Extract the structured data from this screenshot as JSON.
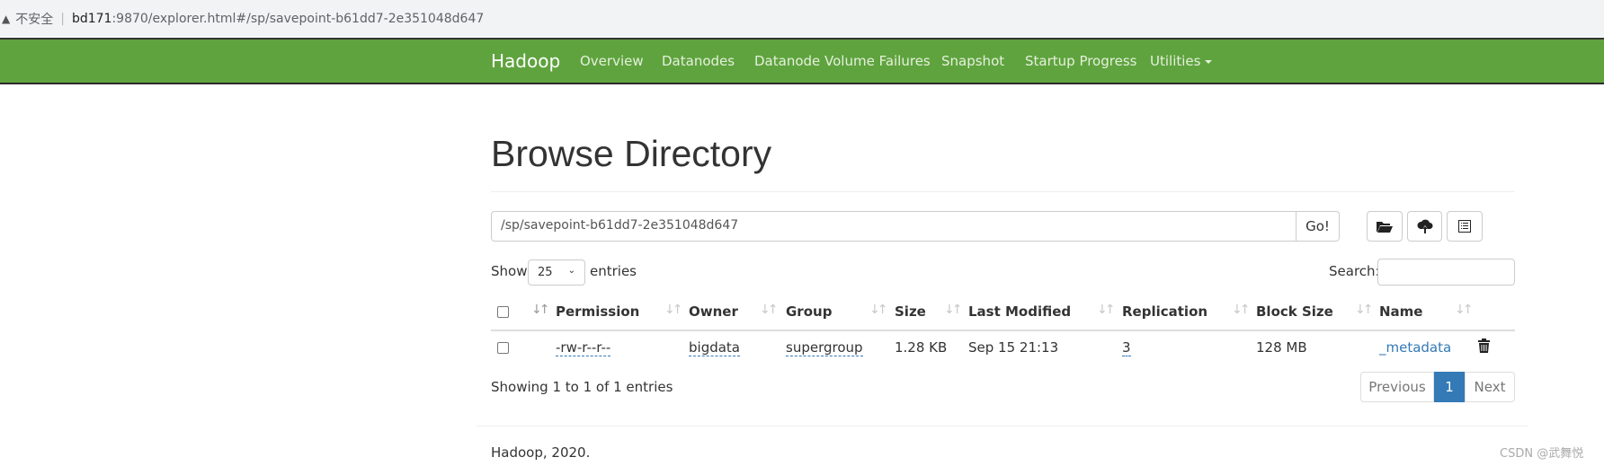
{
  "browser": {
    "warning_icon": "warning-triangle-icon",
    "insecure_label": "不安全",
    "url_host": "bd171",
    "url_rest": ":9870/explorer.html#/sp/savepoint-b61dd7-2e351048d647"
  },
  "nav": {
    "brand": "Hadoop",
    "items": [
      "Overview",
      "Datanodes",
      "Datanode Volume Failures",
      "Snapshot",
      "Startup Progress",
      "Utilities"
    ],
    "color": "#5fa33e"
  },
  "page": {
    "title": "Browse Directory"
  },
  "path": {
    "value": "/sp/savepoint-b61dd7-2e351048d647",
    "go_label": "Go!"
  },
  "toolbar": {
    "icons": [
      "folder-open-icon",
      "cloud-upload-icon",
      "list-alt-icon"
    ]
  },
  "table_controls": {
    "show_label": "Show",
    "entries_value": "25",
    "entries_label": "entries",
    "search_label": "Search:",
    "search_value": ""
  },
  "table": {
    "columns": [
      "Permission",
      "Owner",
      "Group",
      "Size",
      "Last Modified",
      "Replication",
      "Block Size",
      "Name"
    ],
    "rows": [
      {
        "permission": "-rw-r--r--",
        "owner": "bigdata",
        "group": "supergroup",
        "size": "1.28 KB",
        "last_modified": "Sep 15 21:13",
        "replication": "3",
        "block_size": "128 MB",
        "name": "_metadata"
      }
    ]
  },
  "info": "Showing 1 to 1 of 1 entries",
  "pagination": {
    "previous": "Previous",
    "current": "1",
    "next": "Next",
    "accent": "#337ab7"
  },
  "footer": "Hadoop, 2020.",
  "watermark": "CSDN @武舞悦"
}
